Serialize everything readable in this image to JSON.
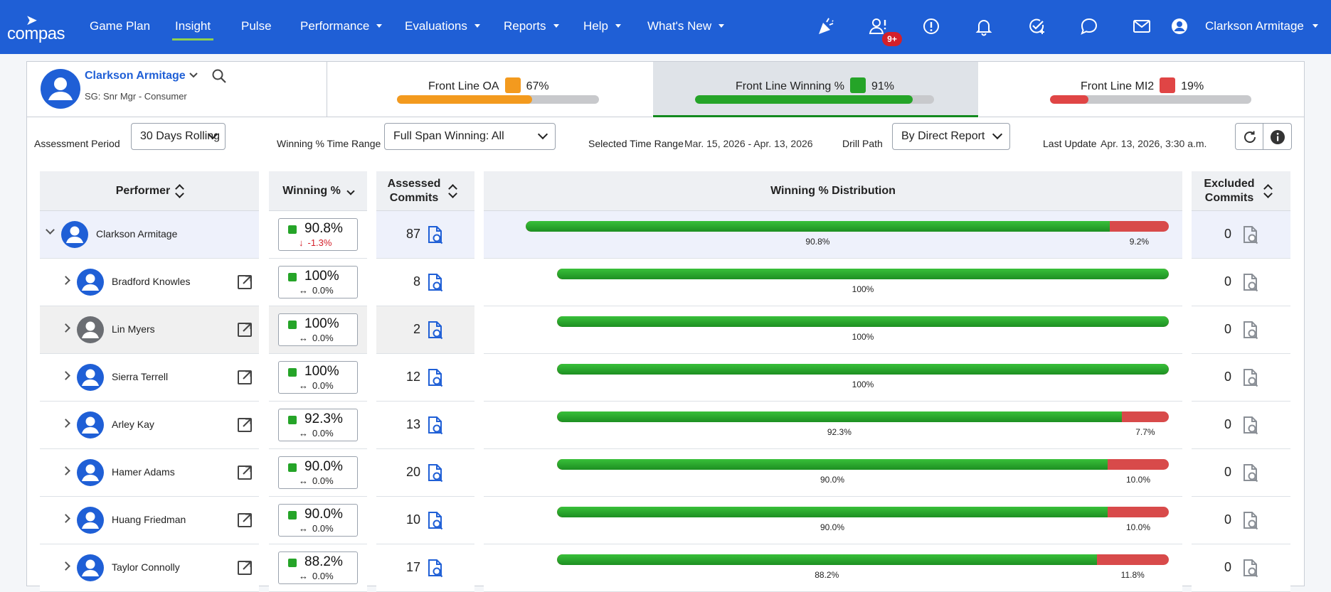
{
  "nav": {
    "logo": "compas",
    "items": [
      {
        "label": "Game Plan",
        "dropdown": false
      },
      {
        "label": "Insight",
        "dropdown": false,
        "active": true
      },
      {
        "label": "Pulse",
        "dropdown": false
      },
      {
        "label": "Performance",
        "dropdown": true
      },
      {
        "label": "Evaluations",
        "dropdown": true
      },
      {
        "label": "Reports",
        "dropdown": true
      },
      {
        "label": "Help",
        "dropdown": true
      },
      {
        "label": "What's New",
        "dropdown": true
      }
    ],
    "icons": [
      "celebrate-icon",
      "team-alert-icon",
      "alert-icon",
      "bell-icon",
      "task-check-icon",
      "chat-icon",
      "mail-icon",
      "user-icon"
    ],
    "badge": "9+",
    "user_name": "Clarkson Armitage"
  },
  "performer_header": {
    "name": "Clarkson Armitage",
    "subtitle": "SG: Snr Mgr - Consumer"
  },
  "kpis": [
    {
      "label": "Front Line OA",
      "percent_text": "67%",
      "value": 67,
      "color": "#f39a1e",
      "selected": false
    },
    {
      "label": "Front Line Winning %",
      "percent_text": "91%",
      "value": 91,
      "color": "#25a428",
      "selected": true
    },
    {
      "label": "Front Line MI2",
      "percent_text": "19%",
      "value": 19,
      "color": "#e04545",
      "selected": false
    }
  ],
  "filters": {
    "assessment_period_label": "Assessment Period",
    "assessment_period_value": "30 Days Rolling",
    "winning_range_label": "Winning % Time Range",
    "winning_range_value": "Full Span Winning: All",
    "selected_range_label": "Selected Time Range",
    "selected_range_value": "Mar. 15, 2026 - Apr. 13, 2026",
    "drill_path_label": "Drill Path",
    "drill_path_value": "By Direct Report",
    "last_update_label": "Last Update",
    "last_update_value": "Apr. 13, 2026, 3:30 a.m."
  },
  "table": {
    "headers": {
      "performer": "Performer",
      "winning": "Winning %",
      "assessed": "Assessed Commits",
      "distribution": "Winning % Distribution",
      "excluded": "Excluded Commits"
    },
    "rows": [
      {
        "name": "Clarkson Armitage",
        "level": 0,
        "expanded": true,
        "avatar_color": "#1f5fd6",
        "winning": "90.8%",
        "delta": "-1.3%",
        "delta_dir": "down",
        "assessed": "87",
        "green": 90.8,
        "red": 9.2,
        "green_label": "90.8%",
        "red_label": "9.2%",
        "excluded": "0",
        "highlight": true,
        "gray": false
      },
      {
        "name": "Bradford Knowles",
        "level": 1,
        "expanded": false,
        "avatar_color": "#1f5fd6",
        "winning": "100%",
        "delta": "0.0%",
        "delta_dir": "flat",
        "assessed": "8",
        "green": 100,
        "red": 0,
        "green_label": "100%",
        "red_label": "",
        "excluded": "0",
        "highlight": false,
        "gray": false
      },
      {
        "name": "Lin Myers",
        "level": 1,
        "expanded": false,
        "avatar_color": "#6b6e73",
        "winning": "100%",
        "delta": "0.0%",
        "delta_dir": "flat",
        "assessed": "2",
        "green": 100,
        "red": 0,
        "green_label": "100%",
        "red_label": "",
        "excluded": "0",
        "highlight": false,
        "gray": true
      },
      {
        "name": "Sierra Terrell",
        "level": 1,
        "expanded": false,
        "avatar_color": "#1f5fd6",
        "winning": "100%",
        "delta": "0.0%",
        "delta_dir": "flat",
        "assessed": "12",
        "green": 100,
        "red": 0,
        "green_label": "100%",
        "red_label": "",
        "excluded": "0",
        "highlight": false,
        "gray": false
      },
      {
        "name": "Arley Kay",
        "level": 1,
        "expanded": false,
        "avatar_color": "#1f5fd6",
        "winning": "92.3%",
        "delta": "0.0%",
        "delta_dir": "flat",
        "assessed": "13",
        "green": 92.3,
        "red": 7.7,
        "green_label": "92.3%",
        "red_label": "7.7%",
        "excluded": "0",
        "highlight": false,
        "gray": false
      },
      {
        "name": "Hamer Adams",
        "level": 1,
        "expanded": false,
        "avatar_color": "#1f5fd6",
        "winning": "90.0%",
        "delta": "0.0%",
        "delta_dir": "flat",
        "assessed": "20",
        "green": 90.0,
        "red": 10.0,
        "green_label": "90.0%",
        "red_label": "10.0%",
        "excluded": "0",
        "highlight": false,
        "gray": false
      },
      {
        "name": "Huang Friedman",
        "level": 1,
        "expanded": false,
        "avatar_color": "#1f5fd6",
        "winning": "90.0%",
        "delta": "0.0%",
        "delta_dir": "flat",
        "assessed": "10",
        "green": 90.0,
        "red": 10.0,
        "green_label": "90.0%",
        "red_label": "10.0%",
        "excluded": "0",
        "highlight": false,
        "gray": false
      },
      {
        "name": "Taylor Connolly",
        "level": 1,
        "expanded": false,
        "avatar_color": "#1f5fd6",
        "winning": "88.2%",
        "delta": "0.0%",
        "delta_dir": "flat",
        "assessed": "17",
        "green": 88.2,
        "red": 11.8,
        "green_label": "88.2%",
        "red_label": "11.8%",
        "excluded": "0",
        "highlight": false,
        "gray": false
      }
    ]
  }
}
